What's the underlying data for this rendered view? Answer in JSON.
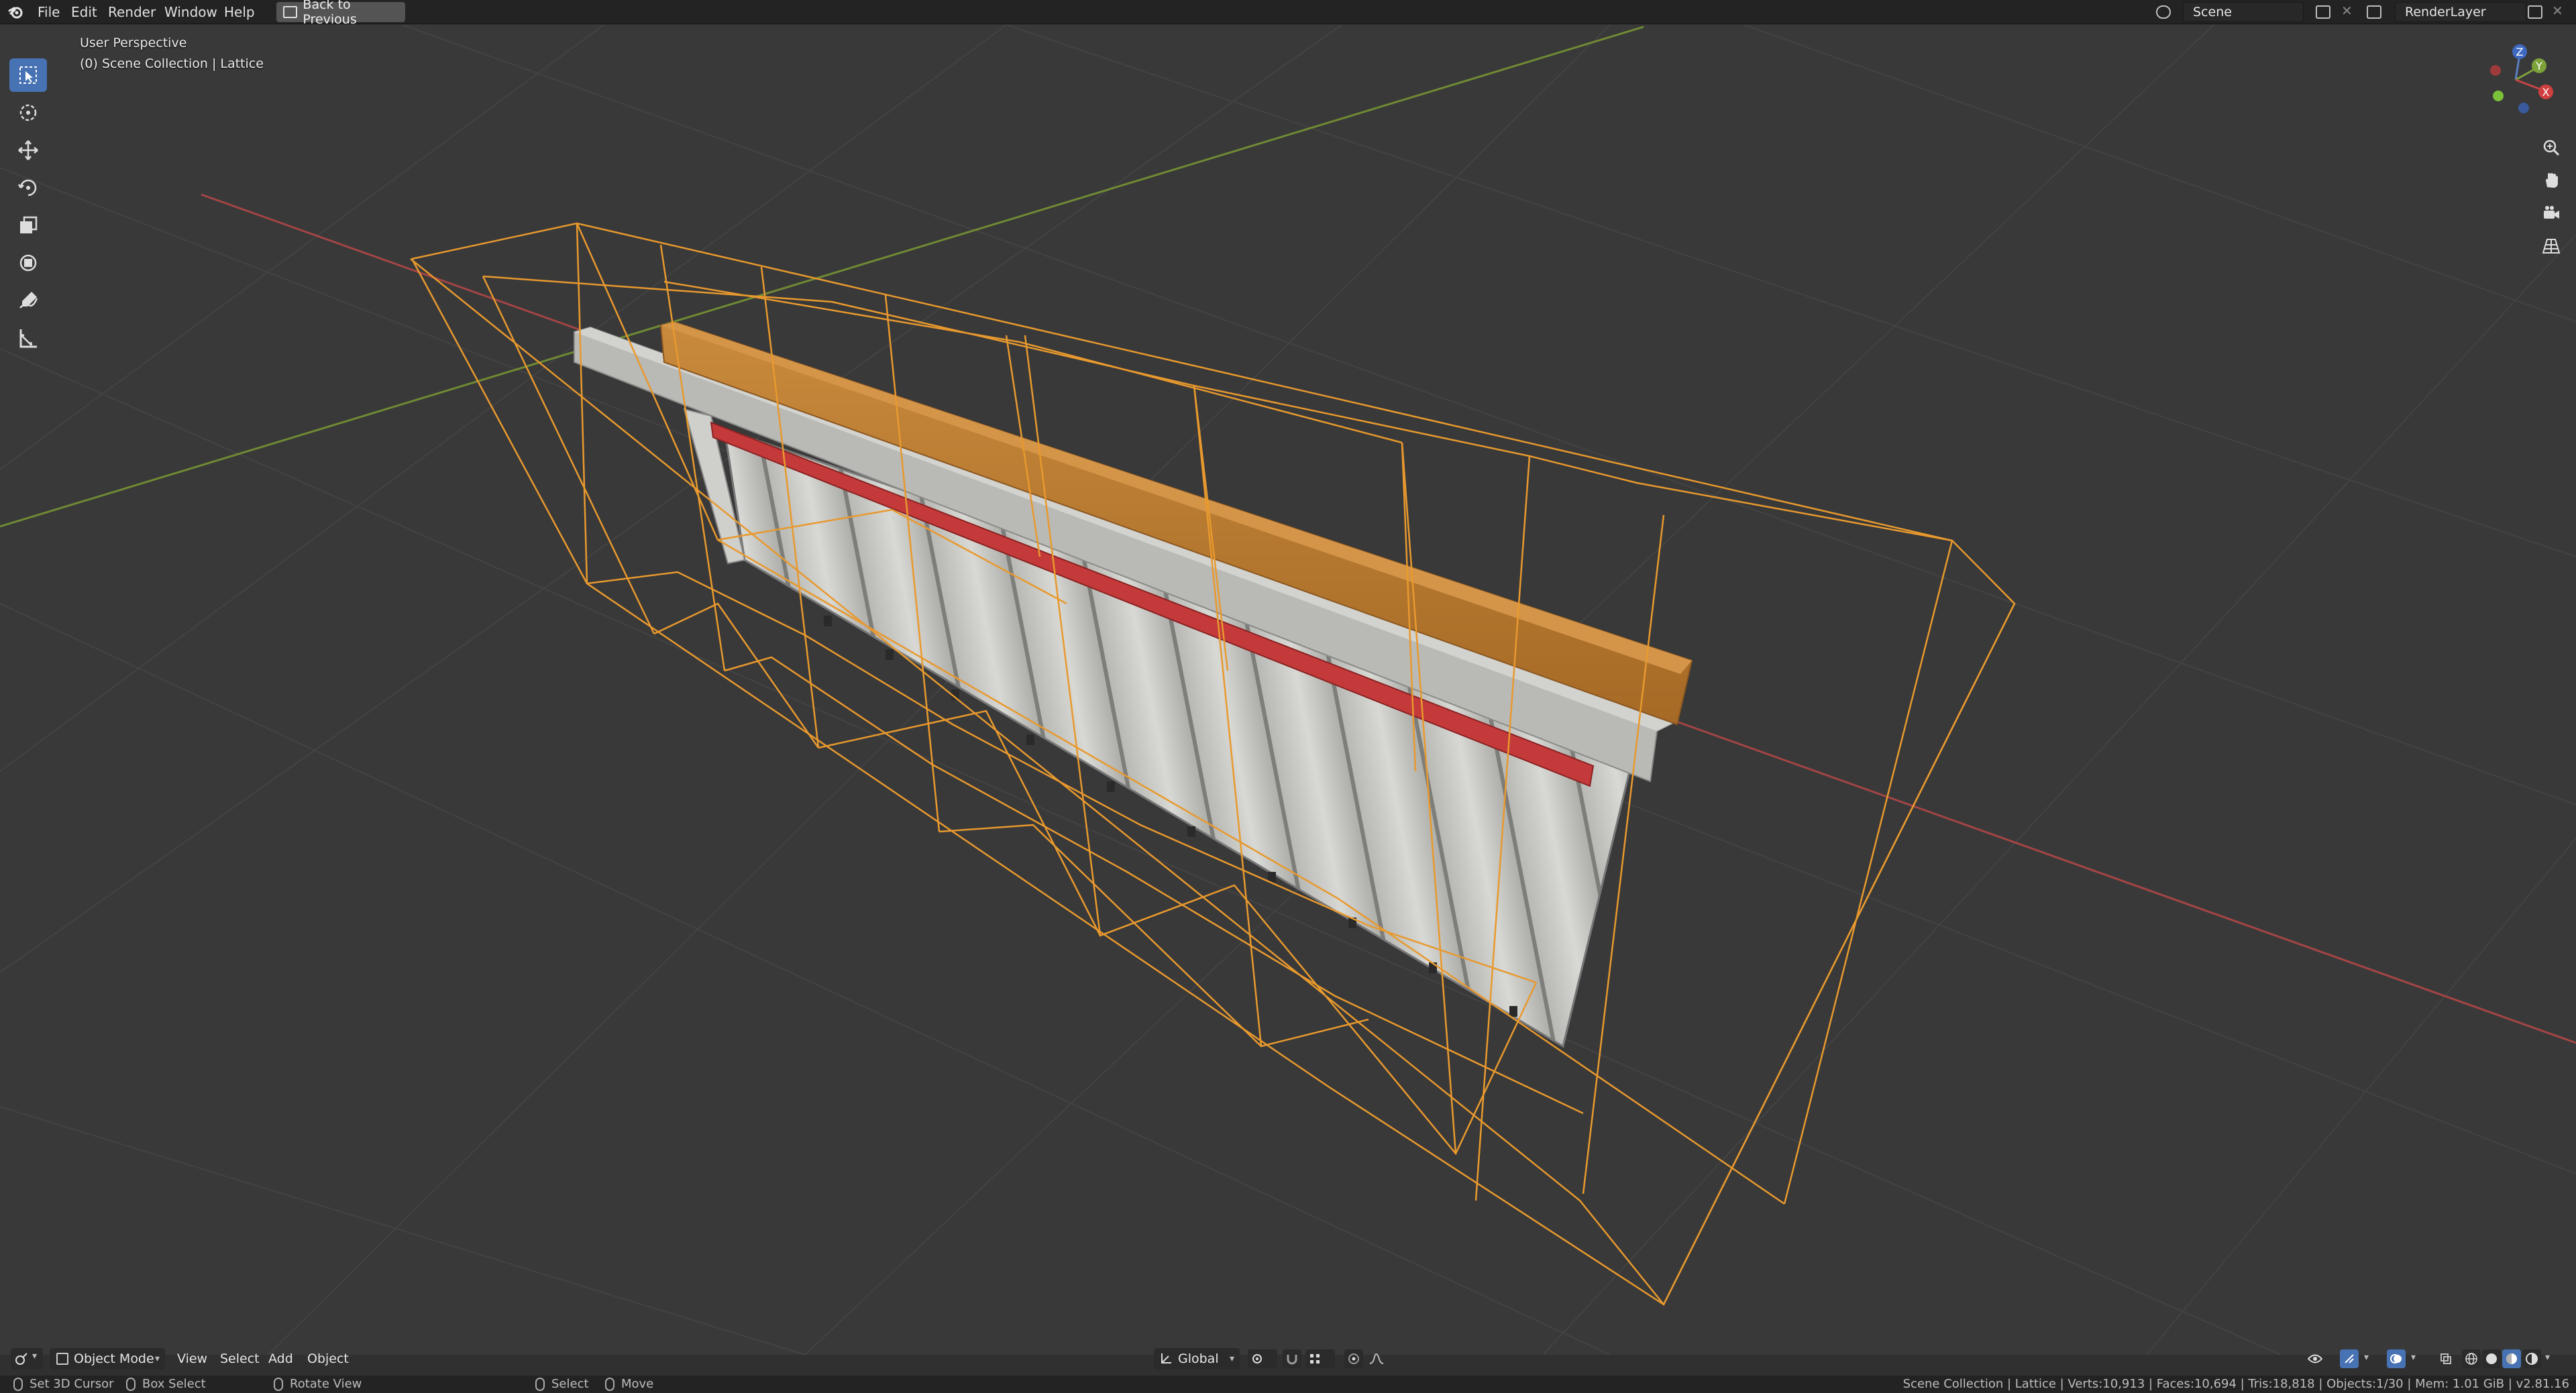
{
  "topbar": {
    "menus": [
      "File",
      "Edit",
      "Render",
      "Window",
      "Help"
    ],
    "back_button": "Back to Previous",
    "scene_name": "Scene",
    "render_layer": "RenderLayer"
  },
  "viewport": {
    "view_name": "User Perspective",
    "collection_info": "(0) Scene Collection | Lattice",
    "gizmo_axes": [
      "Z",
      "Y",
      "X"
    ]
  },
  "header": {
    "mode": "Object Mode",
    "menus": [
      "View",
      "Select",
      "Add",
      "Object"
    ],
    "orientation": "Global"
  },
  "statusbar": {
    "hints": [
      "Set 3D Cursor",
      "Box Select",
      "Rotate View",
      "Select",
      "Move"
    ],
    "stats": "Scene Collection | Lattice | Verts:10,913 | Faces:10,694 | Tris:18,818 | Objects:1/30 | Mem: 1.01 GiB | v2.81.16"
  },
  "colors": {
    "accent": "#4772b3",
    "lattice": "#e8992e",
    "x_axis": "#b34a4a",
    "y_axis": "#7a9a3a"
  },
  "icons": {
    "tools": [
      "select-box-icon",
      "cursor-icon",
      "move-icon",
      "rotate-icon",
      "scale-icon",
      "transform-icon",
      "annotate-icon",
      "measure-icon"
    ],
    "nav": [
      "zoom-icon",
      "pan-icon",
      "camera-icon",
      "perspective-grid-icon"
    ]
  }
}
